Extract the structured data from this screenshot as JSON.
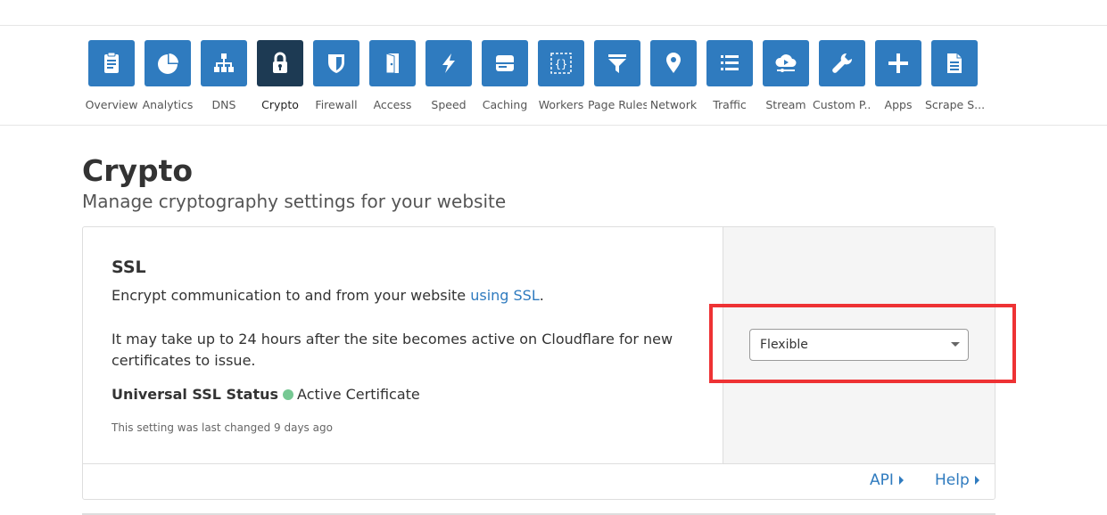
{
  "nav": {
    "items": [
      {
        "label": "Overview",
        "icon": "clipboard-icon"
      },
      {
        "label": "Analytics",
        "icon": "pie-chart-icon"
      },
      {
        "label": "DNS",
        "icon": "sitemap-icon"
      },
      {
        "label": "Crypto",
        "icon": "lock-icon",
        "active": true
      },
      {
        "label": "Firewall",
        "icon": "shield-icon"
      },
      {
        "label": "Access",
        "icon": "door-icon"
      },
      {
        "label": "Speed",
        "icon": "lightning-icon"
      },
      {
        "label": "Caching",
        "icon": "server-icon"
      },
      {
        "label": "Workers",
        "icon": "code-braces-icon"
      },
      {
        "label": "Page Rules",
        "icon": "filter-icon"
      },
      {
        "label": "Network",
        "icon": "map-pin-icon"
      },
      {
        "label": "Traffic",
        "icon": "list-icon"
      },
      {
        "label": "Stream",
        "icon": "cloud-play-icon"
      },
      {
        "label": "Custom P...",
        "icon": "wrench-icon"
      },
      {
        "label": "Apps",
        "icon": "plus-icon"
      },
      {
        "label": "Scrape S...",
        "icon": "document-icon"
      }
    ]
  },
  "page": {
    "title": "Crypto",
    "subtitle": "Manage cryptography settings for your website"
  },
  "ssl": {
    "title": "SSL",
    "desc_prefix": "Encrypt communication to and from your website ",
    "desc_link": "using SSL",
    "desc_suffix": ".",
    "note": "It may take up to 24 hours after the site becomes active on Cloudflare for new certificates to issue.",
    "status_label": "Universal SSL Status",
    "status_value": "Active Certificate",
    "status_color": "#76c893",
    "last_changed": "This setting was last changed 9 days ago",
    "mode_value": "Flexible"
  },
  "footer": {
    "api_label": "API",
    "help_label": "Help"
  },
  "colors": {
    "accent": "#2f7bbf",
    "active_tile": "#1d3a53",
    "highlight": "#ee3234"
  }
}
